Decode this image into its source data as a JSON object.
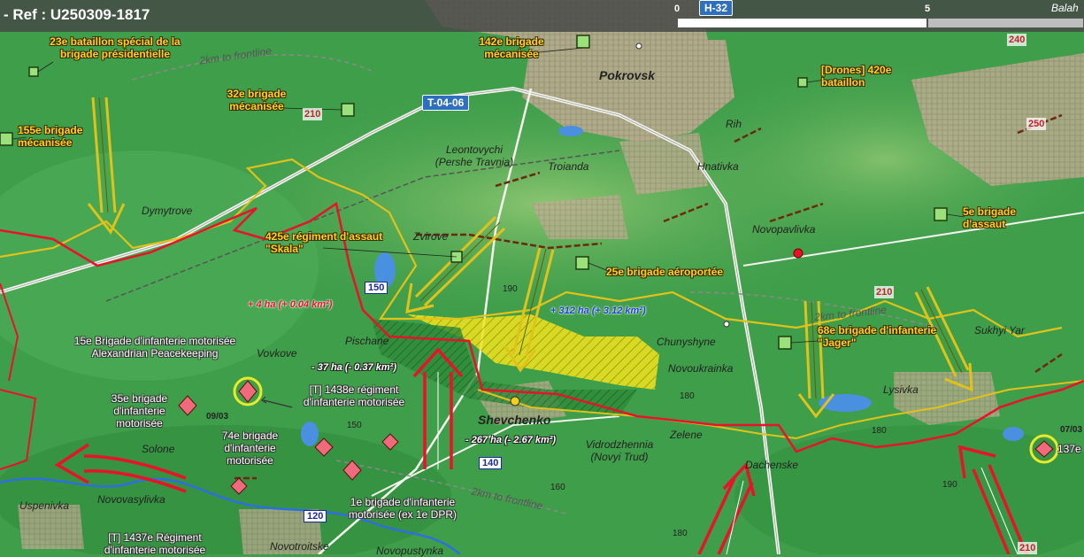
{
  "header": {
    "ref": "- Ref : U250309-1817",
    "scale_start": "0",
    "scale_mid": "5",
    "corner_town": "Balah"
  },
  "roads": {
    "h32": "H-32",
    "t0406": "T-04-06",
    "r150": "150",
    "r140": "140",
    "r120": "120",
    "r210a": "210",
    "r210b": "210",
    "r210c": "210",
    "r240": "240",
    "r250": "250"
  },
  "units": {
    "u23": "23e bataillon spécial de la brigade présidentielle",
    "u32": "32e brigade mécanisée",
    "u155": "155e brigade mécanisée",
    "u142": "142e brigade mécanisée",
    "u420": "[Drones] 420e bataillon",
    "u5": "5e brigade d'assaut",
    "u425": "425e régiment d'assaut \"Skala\"",
    "u25": "25e brigade aéroportée",
    "u68": "68e brigade d'infanterie \"Jager\"",
    "u15": "15e Brigade d'infanterie motorisée Alexandrian Peacekeeping",
    "u35": "35e brigade d'infanterie motorisée",
    "u1438": "[T] 1438e régiment d'infanterie motorisée",
    "u74": "74e brigade d'infanterie motorisée",
    "u1": "1e brigade d'infanterie motorisée (ex 1e DPR)",
    "u1437": "[T] 1437e Régiment d'infanterie motorisée",
    "u137": "137e"
  },
  "towns": {
    "pokrovsk": "Pokrovsk",
    "rih": "Rih",
    "hnativka": "Hnativka",
    "leontovychi": "Leontovychi (Pershe Travnia)",
    "troianda": "Troianda",
    "dymytrove": "Dymytrove",
    "zvirove": "Zvirove",
    "novopavlivka": "Novopavlivka",
    "pischane": "Pischane",
    "vovkove": "Vovkove",
    "chunyshyne": "Chunyshyne",
    "novoukrainka": "Novoukrainka",
    "sukhyi_yar": "Sukhyi Yar",
    "lysivka": "Lysivka",
    "shevchenko": "Shevchenko",
    "zelene": "Zelene",
    "vidrodzhennia": "Vidrodzhennia (Novyi Trud)",
    "dachenske": "Dachenske",
    "solone": "Solone",
    "novovasylivka": "Novovasylivka",
    "uspenivka": "Uspenivka",
    "novotroitske": "Novotroitske",
    "novopustynka": "Novopustynka"
  },
  "areas": {
    "plus4": "+ 4 ha (+ 0.04 km²)",
    "minus37": "- 37 ha (- 0.37 km²)",
    "plus312": "+ 312 ha (+ 3.12 km²)",
    "minus267": "- 267 ha (- 2.67 km²)"
  },
  "frontline": {
    "f1": "2km to frontline",
    "f2": "2km to frontline",
    "f3": "2km to frontline"
  },
  "elevations": {
    "e190a": "190",
    "e180a": "180",
    "e150": "150",
    "e160": "160",
    "e180b": "180",
    "e190b": "190",
    "e180c": "180"
  },
  "dates": {
    "d0903": "09/03",
    "d0703": "07/03"
  },
  "colors": {
    "russian_line": "#e8122a",
    "ukrainian_line": "#e0c21a",
    "gain": "#f2e51e",
    "terrain": "#3f9e4a",
    "urban": "#b9a38c"
  }
}
